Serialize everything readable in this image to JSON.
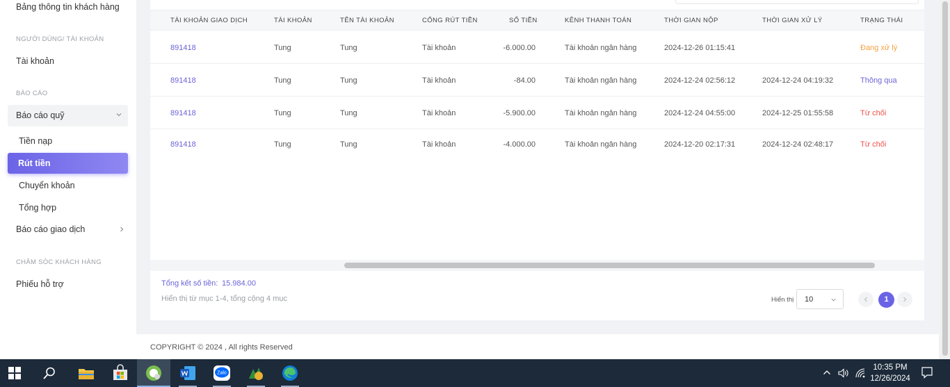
{
  "sidebar": {
    "customer_info": "Bảng thông tin khách hàng",
    "section_users": "NGƯỜI DÙNG/ TÀI KHOẢN",
    "account": "Tài khoản",
    "section_reports": "BÁO CÁO",
    "fund_report": "Báo cáo quỹ",
    "deposit": "Tiền nạp",
    "withdraw": "Rút tiền",
    "transfer": "Chuyển khoản",
    "summary": "Tổng hợp",
    "trade_report": "Báo cáo giao dịch",
    "section_care": "CHĂM SÓC KHÁCH HÀNG",
    "support_ticket": "Phiếu hỗ trợ"
  },
  "table": {
    "headers": [
      "TÀI KHOẢN GIAO DỊCH",
      "TÀI KHOẢN",
      "TÊN TÀI KHOẢN",
      "CỔNG RÚT TIỀN",
      "SỐ TIỀN",
      "KÊNH THANH TOÁN",
      "THỜI GIAN NỘP",
      "THỜI GIAN XỬ LÝ",
      "TRẠNG THÁI"
    ],
    "rows": [
      [
        "891418",
        "Tung",
        "Tung",
        "Tài khoản",
        "-6.000.00",
        "Tài khoản ngân hàng",
        "2024-12-26 01:15:41",
        "",
        "Đang xử lý"
      ],
      [
        "891418",
        "Tung",
        "Tung",
        "Tài khoản",
        "-84.00",
        "Tài khoản ngân hàng",
        "2024-12-24 02:56:12",
        "2024-12-24 04:19:32",
        "Thông qua"
      ],
      [
        "891418",
        "Tung",
        "Tung",
        "Tài khoản",
        "-5.900.00",
        "Tài khoản ngân hàng",
        "2024-12-24 04:55:00",
        "2024-12-25 01:55:58",
        "Từ chối"
      ],
      [
        "891418",
        "Tung",
        "Tung",
        "Tài khoản",
        "-4.000.00",
        "Tài khoản ngân hàng",
        "2024-12-20 02:17:31",
        "2024-12-24 02:48:17",
        "Từ chối"
      ]
    ]
  },
  "summary": {
    "total_label": "Tổng kết số tiền:",
    "total_value": "15.984.00",
    "range_text": "Hiển thị từ mục 1-4, tổng cộng 4 mục"
  },
  "pagination": {
    "show_label": "Hiển thị",
    "page_size": "10",
    "current_page": "1"
  },
  "footer": {
    "copyright": "COPYRIGHT © 2024 , All rights Reserved"
  },
  "taskbar": {
    "time": "10:35 PM",
    "date": "12/26/2024",
    "icons": [
      "windows-start-icon",
      "search-icon",
      "file-explorer-icon",
      "store-icon",
      "app-icon",
      "word-icon",
      "zalo-icon",
      "metatrader-icon",
      "edge-icon"
    ]
  },
  "colors": {
    "accent": "#6b63e6",
    "pending": "#f5a142",
    "pass": "#6a64d8",
    "reject": "#f0504a"
  }
}
